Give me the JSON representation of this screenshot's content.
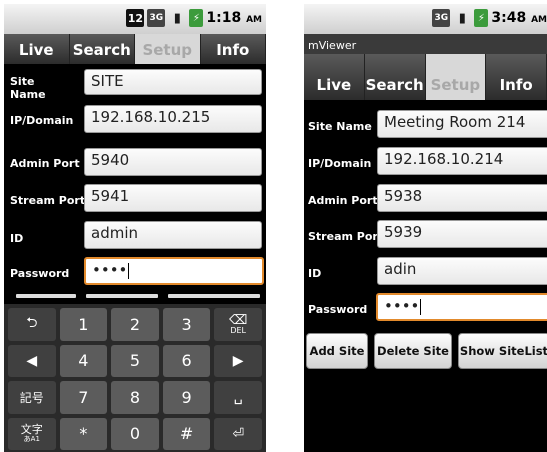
{
  "phone1": {
    "status": {
      "badge": "12",
      "network": "3G",
      "time": "1:18",
      "ampm": "AM"
    },
    "tabs": [
      "Live",
      "Search",
      "Setup",
      "Info"
    ],
    "fields": [
      {
        "label": "Site Name",
        "value": "SITE"
      },
      {
        "label": "IP/Domain",
        "value": "192.168.10.215"
      },
      {
        "label": "Admin Port",
        "value": "5940"
      },
      {
        "label": "Stream Port",
        "value": "5941"
      },
      {
        "label": "ID",
        "value": "admin"
      },
      {
        "label": "Password",
        "value": "••••"
      }
    ],
    "keyboard": {
      "keys": [
        "⮌",
        "1",
        "2",
        "3",
        "⌫",
        "◀",
        "4",
        "5",
        "6",
        "▶",
        "記号",
        "7",
        "8",
        "9",
        "␣",
        "文字",
        "*",
        "0",
        "#",
        "⏎"
      ],
      "del_label": "DEL",
      "mode_sub": "あA1"
    }
  },
  "phone2": {
    "status": {
      "network": "3G",
      "time": "3:48",
      "ampm": "AM"
    },
    "app_title": "mViewer",
    "tabs": [
      "Live",
      "Search",
      "Setup",
      "Info"
    ],
    "fields": [
      {
        "label": "Site Name",
        "value": "Meeting Room 214"
      },
      {
        "label": "IP/Domain",
        "value": "192.168.10.214"
      },
      {
        "label": "Admin Port",
        "value": "5938"
      },
      {
        "label": "Stream Port",
        "value": "5939"
      },
      {
        "label": "ID",
        "value": "adin"
      },
      {
        "label": "Password",
        "value": "••••"
      }
    ],
    "buttons": [
      "Add Site",
      "Delete Site",
      "Show SiteList"
    ]
  }
}
